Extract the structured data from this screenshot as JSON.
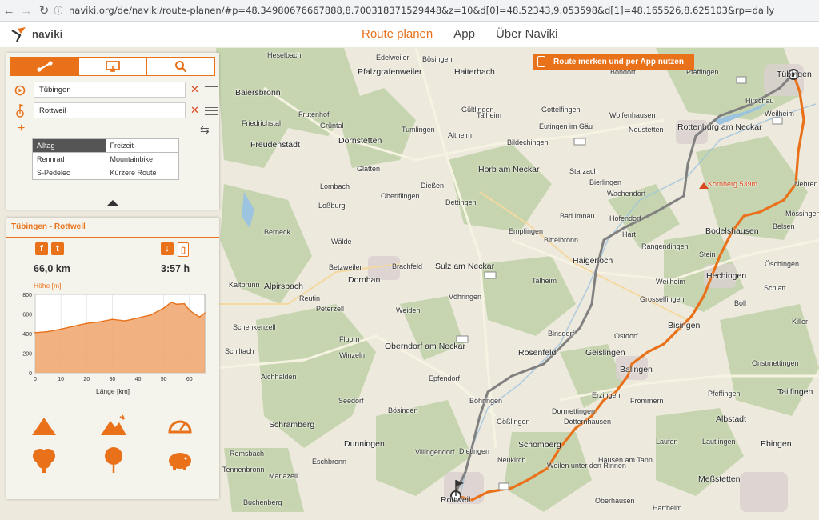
{
  "browser": {
    "url": "naviki.org/de/naviki/route-planen/#p=48.34980676667888,8.700318371529448&z=10&d[0]=48.52343,9.053598&d[1]=48.165526,8.625103&rp=daily"
  },
  "header": {
    "logo": "naviki",
    "nav": [
      "Route planen",
      "App",
      "Über Naviki"
    ],
    "active_index": 0,
    "accent": "#e8711a"
  },
  "app_banner": "Route merken und per App nutzen",
  "planner": {
    "tabs": [
      "route-icon",
      "import-icon",
      "search-icon"
    ],
    "start": "Tübingen",
    "destination": "Rottweil",
    "profiles": [
      [
        "Alltag",
        "Freizeit"
      ],
      [
        "Rennrad",
        "Mountainbike"
      ],
      [
        "S-Pedelec",
        "Kürzere Route"
      ]
    ],
    "selected_profile": "Alltag"
  },
  "route": {
    "title": "Tübingen - Rottweil",
    "distance": "66,0 km",
    "duration": "3:57 h",
    "elevation_label": "Höhe [m]",
    "length_label": "Länge [km]"
  },
  "chart_data": {
    "type": "area",
    "x": [
      0,
      5,
      10,
      15,
      20,
      25,
      30,
      35,
      40,
      45,
      50,
      53,
      55,
      58,
      60,
      62,
      64,
      66
    ],
    "values": [
      410,
      420,
      445,
      475,
      505,
      520,
      545,
      530,
      560,
      590,
      660,
      720,
      700,
      705,
      640,
      600,
      570,
      610
    ],
    "xlabel": "Länge [km]",
    "ylabel": "Höhe [m]",
    "xlim": [
      0,
      66
    ],
    "ylim": [
      0,
      800
    ],
    "xticks": [
      0,
      10,
      20,
      30,
      40,
      50,
      60
    ],
    "yticks": [
      0,
      200,
      400,
      600,
      800
    ],
    "grid": true,
    "color": "#e8711a"
  },
  "actions": [
    "ascent-icon",
    "mountain-icon",
    "speedometer-icon",
    "tree-icon",
    "balloon-icon",
    "piggy-bank-icon"
  ],
  "map": {
    "places": [
      "Heselbach",
      "Edelweiler",
      "Bösingen",
      "Pfalzgrafenweiler",
      "Haiterbach",
      "Bondorf",
      "Pfäffingen",
      "Tübingen",
      "Baiersbronn",
      "Frutenhof",
      "Hirschau",
      "Gültlingen",
      "Gottelfingen",
      "Wolfenhausen",
      "Weilheim",
      "Grüntal",
      "Tumlingen",
      "Talheim",
      "Eutingen im Gäu",
      "Neustetten",
      "Friedrichstal",
      "Freudenstadt",
      "Dornstetten",
      "Altheim",
      "Bildechingen",
      "Rottenburg am Neckar",
      "Horb am Neckar",
      "Starzach",
      "Glatten",
      "Dießen",
      "Bierlingen",
      "Kornberg 539m",
      "Nehren",
      "Lombach",
      "Oberiflingen",
      "Dettingen",
      "Wachendorf",
      "Bad Imnau",
      "Hofendorf",
      "Mössingen",
      "Loßburg",
      "Empfingen",
      "Hart",
      "Bodelshausen",
      "Belsen",
      "Berneck",
      "Wälde",
      "Brachfeld",
      "Sulz am Neckar",
      "Haigerloch",
      "Rangendingen",
      "Betzweiler",
      "Bittelbronn",
      "Stein",
      "Öschingen",
      "Kaltbrunn",
      "Alpirsbach",
      "Dornhan",
      "Vöhringen",
      "Hechingen",
      "Talheim",
      "Reutin",
      "Weilheim",
      "Schlatt",
      "Peterzell",
      "Weiden",
      "Grosselfingen",
      "Boll",
      "Schenkenzell",
      "Bisingen",
      "Killer",
      "Fluorn",
      "Binsdorf",
      "Ostdorf",
      "Schiltach",
      "Winzeln",
      "Oberndorf am Neckar",
      "Rosenfeld",
      "Geislingen",
      "Onstmettingen",
      "Balingen",
      "Aichhalden",
      "Epfendorf",
      "Erzingen",
      "Frommern",
      "Pfeffingen",
      "Tailfingen",
      "Seedorf",
      "Böhringen",
      "Dormettingen",
      "Albstadt",
      "Bösingen",
      "Gößlingen",
      "Dotternhausen",
      "Schramberg",
      "Dunningen",
      "Villingendorf",
      "Schömberg",
      "Laufen",
      "Lautlingen",
      "Ebingen",
      "Dietingen",
      "Rems­bach",
      "Eschbronn",
      "Neukirch",
      "Weilen unter den Rinnen",
      "Hausen am Tann",
      "Mariazell",
      "Tennenbronn",
      "Rottweil",
      "Meßstetten",
      "Buchenberg",
      "Hartheim",
      "Oberhausen"
    ]
  }
}
